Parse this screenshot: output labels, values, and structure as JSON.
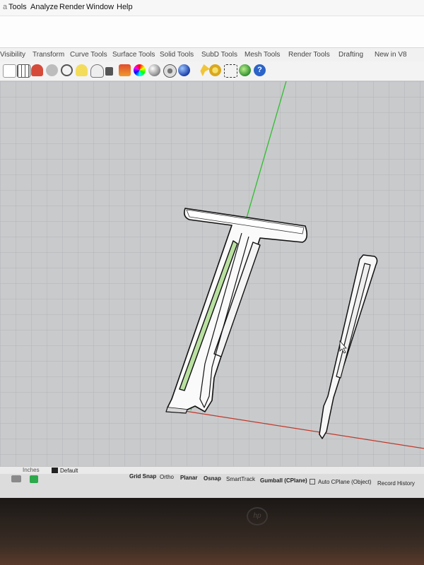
{
  "menu": [
    "Tools",
    "Analyze",
    "Render",
    "Window",
    "Help"
  ],
  "tabs": [
    "Visibility",
    "Transform",
    "Curve Tools",
    "Surface Tools",
    "Solid Tools",
    "SubD Tools",
    "Mesh Tools",
    "Render Tools",
    "Drafting",
    "New in V8"
  ],
  "toolbar_icons": [
    "cursor-icon",
    "grid-icon",
    "car-icon",
    "cloud-icon",
    "circle-icon",
    "bulb-icon",
    "bulb-icon-2",
    "lock-icon",
    "layers-icon",
    "color-wheel-icon",
    "render-sphere-icon",
    "globe-icon",
    "sphere-icon",
    "pin-icon",
    "gear-icon",
    "hierarchy-icon",
    "globe-green-icon",
    "help-icon"
  ],
  "status": {
    "units": "Inches",
    "layer": "Default",
    "grid_snap": "Grid Snap",
    "ortho": "Ortho",
    "planar": "Planar",
    "osnap": "Osnap",
    "smarttrack": "SmartTrack",
    "gumball": "Gumball (CPlane)",
    "auto_cplane": "Auto CPlane (Object)",
    "record_history": "Record History"
  },
  "bezel": {
    "brand": "hp"
  },
  "colors": {
    "viewport_bg": "#c9cacc",
    "y_axis": "#2fbf2f",
    "x_axis": "#c0392b",
    "selection_fill": "#b9e0a0"
  }
}
